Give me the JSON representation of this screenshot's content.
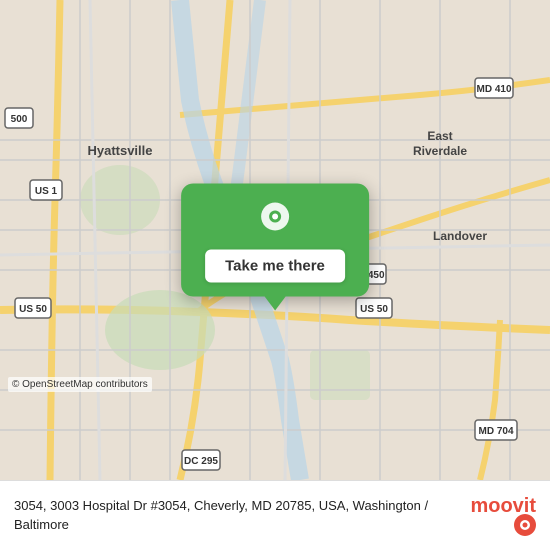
{
  "map": {
    "background_color": "#e8e0d8",
    "attribution": "© OpenStreetMap contributors"
  },
  "button": {
    "label": "Take me there"
  },
  "bottom_bar": {
    "address": "3054, 3003 Hospital Dr #3054, Cheverly, MD 20785, USA, Washington / Baltimore"
  },
  "logo": {
    "text": "moovit",
    "icon": "moovit-logo-icon"
  },
  "icons": {
    "pin": "📍"
  }
}
